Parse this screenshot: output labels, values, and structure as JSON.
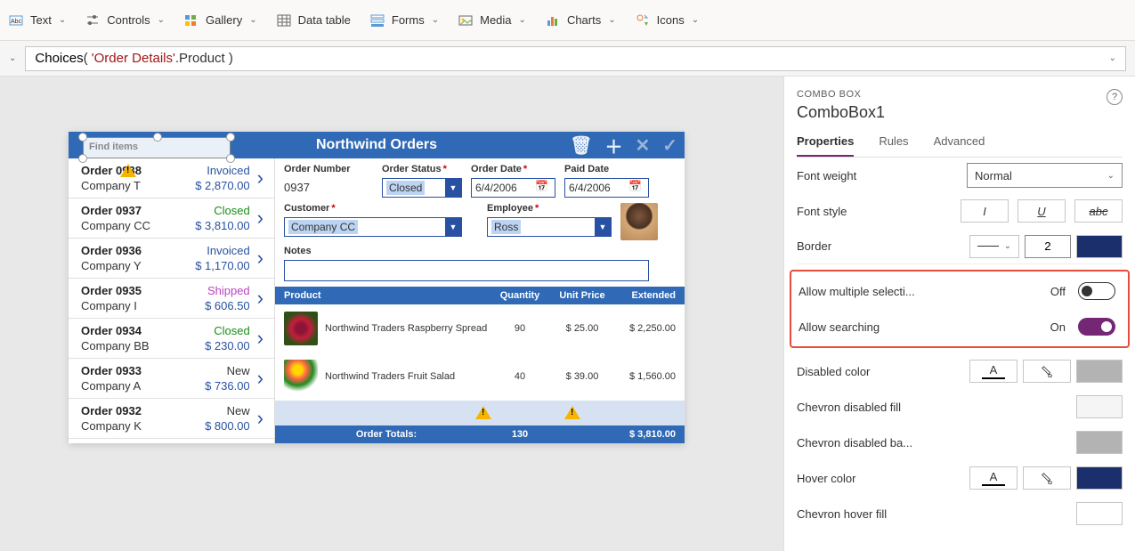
{
  "ribbon": [
    {
      "label": "Text"
    },
    {
      "label": "Controls"
    },
    {
      "label": "Gallery"
    },
    {
      "label": "Data table"
    },
    {
      "label": "Forms"
    },
    {
      "label": "Media"
    },
    {
      "label": "Charts"
    },
    {
      "label": "Icons"
    }
  ],
  "formula": {
    "fn": "Choices",
    "open": "( ",
    "str": "'Order Details'",
    "rest": ".Product )"
  },
  "app": {
    "title": "Northwind Orders",
    "search_placeholder": "Find items"
  },
  "orders": [
    {
      "id": "Order 0938",
      "company": "Company T",
      "status": "Invoiced",
      "status_cls": "st-invoiced",
      "amount": "$ 2,870.00",
      "warn": true
    },
    {
      "id": "Order 0937",
      "company": "Company CC",
      "status": "Closed",
      "status_cls": "st-closed",
      "amount": "$ 3,810.00"
    },
    {
      "id": "Order 0936",
      "company": "Company Y",
      "status": "Invoiced",
      "status_cls": "st-invoiced",
      "amount": "$ 1,170.00"
    },
    {
      "id": "Order 0935",
      "company": "Company I",
      "status": "Shipped",
      "status_cls": "st-shipped",
      "amount": "$ 606.50"
    },
    {
      "id": "Order 0934",
      "company": "Company BB",
      "status": "Closed",
      "status_cls": "st-closed",
      "amount": "$ 230.00"
    },
    {
      "id": "Order 0933",
      "company": "Company A",
      "status": "New",
      "status_cls": "st-new",
      "amount": "$ 736.00"
    },
    {
      "id": "Order 0932",
      "company": "Company K",
      "status": "New",
      "status_cls": "st-new",
      "amount": "$ 800.00"
    }
  ],
  "form": {
    "labels": {
      "order_number": "Order Number",
      "order_status": "Order Status",
      "order_date": "Order Date",
      "paid_date": "Paid Date",
      "customer": "Customer",
      "employee": "Employee",
      "notes": "Notes"
    },
    "order_number": "0937",
    "order_status": "Closed",
    "order_date": "6/4/2006",
    "paid_date": "6/4/2006",
    "customer": "Company CC",
    "employee": "Ross"
  },
  "products": {
    "headers": {
      "product": "Product",
      "qty": "Quantity",
      "unit_price": "Unit Price",
      "extended": "Extended"
    },
    "rows": [
      {
        "name": "Northwind Traders Raspberry Spread",
        "qty": "90",
        "unit": "$ 25.00",
        "ext": "$ 2,250.00"
      },
      {
        "name": "Northwind Traders Fruit Salad",
        "qty": "40",
        "unit": "$ 39.00",
        "ext": "$ 1,560.00"
      }
    ],
    "totals": {
      "label": "Order Totals:",
      "qty": "130",
      "ext": "$ 3,810.00"
    }
  },
  "props": {
    "type": "COMBO BOX",
    "name": "ComboBox1",
    "tabs": [
      "Properties",
      "Rules",
      "Advanced"
    ],
    "font_weight_label": "Font weight",
    "font_weight_value": "Normal",
    "font_style_label": "Font style",
    "border_label": "Border",
    "border_width": "2",
    "border_color": "#1a2f6b",
    "allow_multi_label": "Allow multiple selecti...",
    "allow_multi_value": "Off",
    "allow_search_label": "Allow searching",
    "allow_search_value": "On",
    "disabled_color_label": "Disabled color",
    "disabled_color_sw": "#b3b3b3",
    "chev_disabled_fill_label": "Chevron disabled fill",
    "chev_disabled_fill_sw": "#f5f5f5",
    "chev_disabled_back_label": "Chevron disabled ba...",
    "chev_disabled_back_sw": "#b3b3b3",
    "hover_color_label": "Hover color",
    "hover_color_sw": "#1a2f6b",
    "chev_hover_fill_label": "Chevron hover fill"
  }
}
